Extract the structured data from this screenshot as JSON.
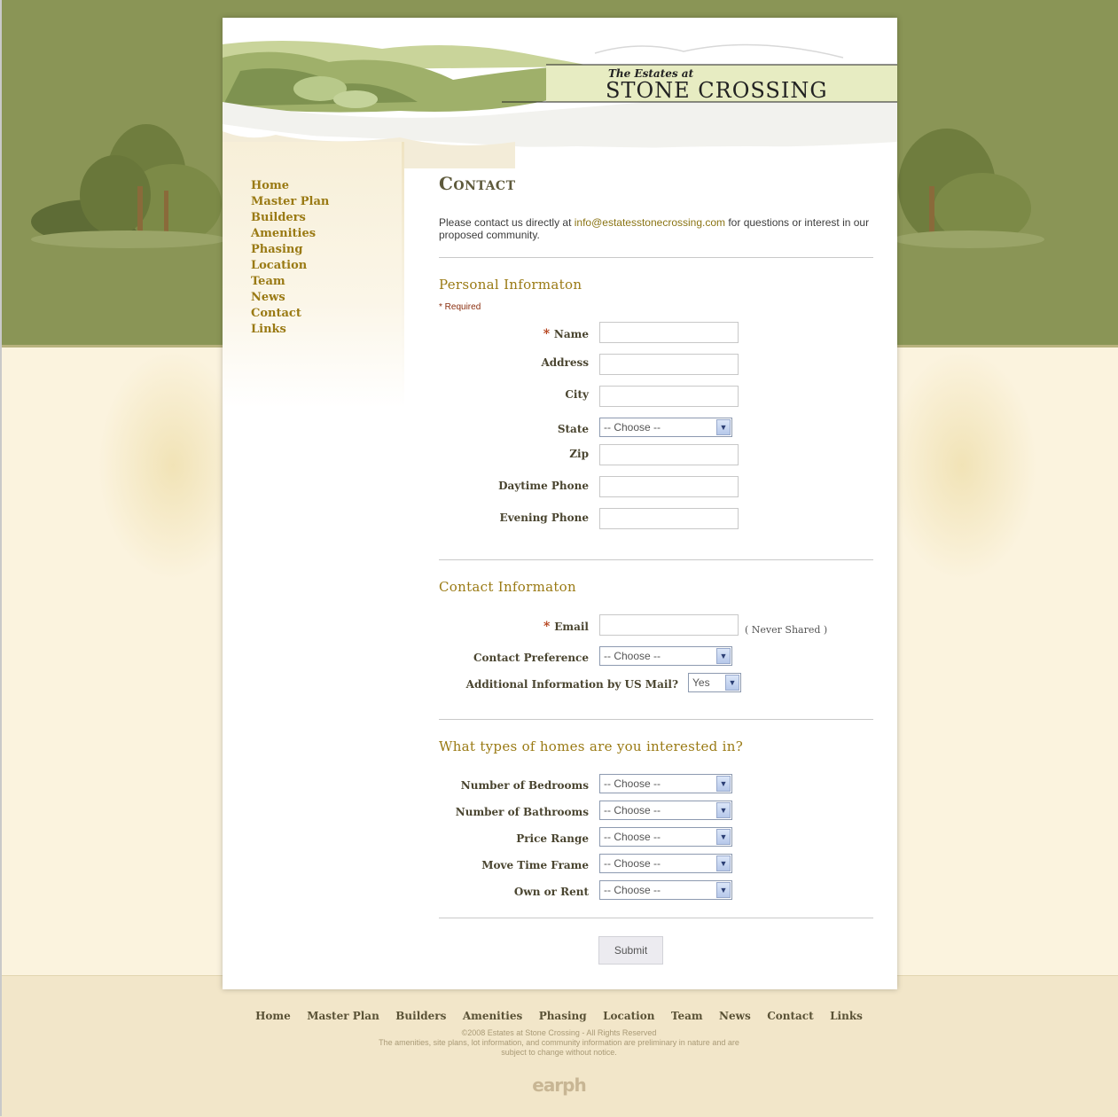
{
  "site": {
    "logo_line1": "The Estates at",
    "logo_line2": "STONE CROSSING"
  },
  "nav": [
    "Home",
    "Master Plan",
    "Builders",
    "Amenities",
    "Phasing",
    "Location",
    "Team",
    "News",
    "Contact",
    "Links"
  ],
  "page_title": "Contact",
  "intro": {
    "before": "Please contact us directly at ",
    "email": "info@estatesstonecrossing.com",
    "after": " for questions or interest in our proposed community."
  },
  "personal": {
    "title": "Personal Informaton",
    "required_note": "* Required",
    "name_label": "Name",
    "address_label": "Address",
    "city_label": "City",
    "state_label": "State",
    "state_value": "-- Choose --",
    "zip_label": "Zip",
    "day_phone_label": "Daytime Phone",
    "eve_phone_label": "Evening Phone"
  },
  "contact": {
    "title": "Contact Informaton",
    "email_label": "Email",
    "email_note": "( Never Shared )",
    "pref_label": "Contact Preference",
    "pref_value": "-- Choose --",
    "mail_label": "Additional Information by US Mail?",
    "mail_value": "Yes"
  },
  "homes": {
    "title": "What types of homes are you interested in?",
    "bedrooms_label": "Number of Bedrooms",
    "bathrooms_label": "Number of Bathrooms",
    "price_label": "Price Range",
    "move_label": "Move Time Frame",
    "own_label": "Own or Rent",
    "choose": "-- Choose --"
  },
  "submit_label": "Submit",
  "footer": {
    "copyright": "©2008 Estates at Stone Crossing - All Rights Reserved",
    "disclaimer1": "The amenities, site plans, lot information, and community information are preliminary in nature and are",
    "disclaimer2": "subject to change without notice.",
    "credit": "earph"
  },
  "colors": {
    "olive_bg": "#8a9556",
    "link_gold": "#9a7a14",
    "cream_bg": "#fbf3de",
    "footer_bg": "#f2e6c9"
  }
}
